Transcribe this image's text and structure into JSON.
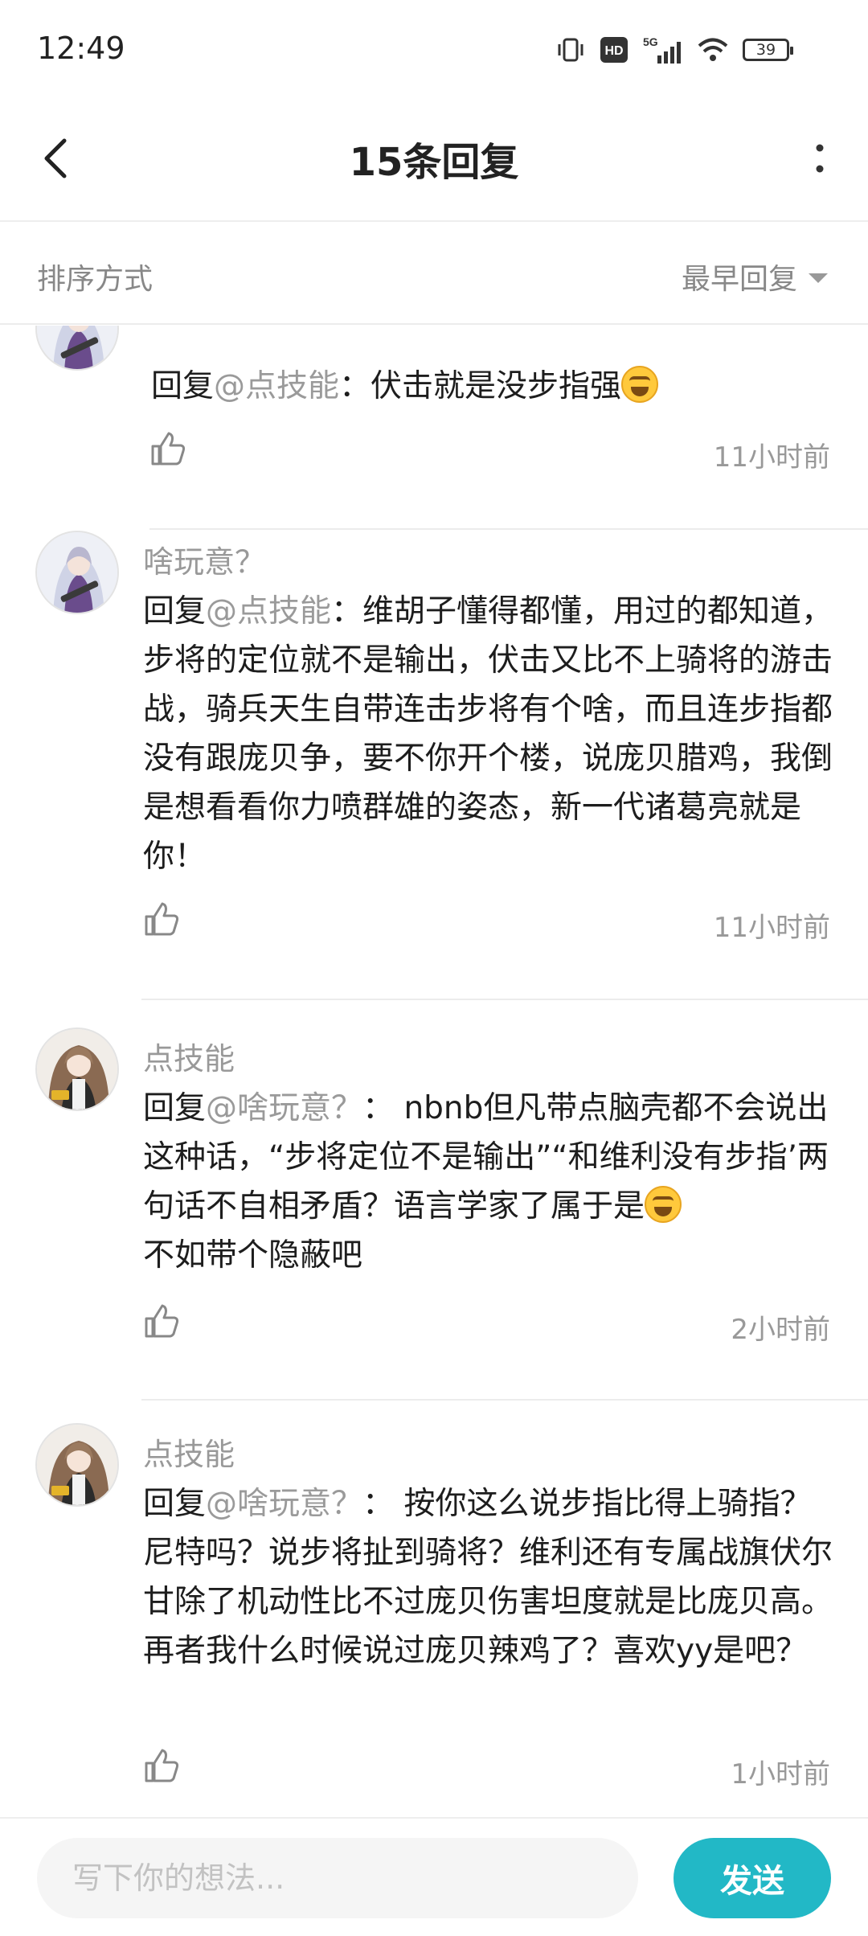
{
  "status_bar": {
    "time": "12:49",
    "network": "5G",
    "battery": "39",
    "icons": [
      "vibrate-icon",
      "hd-icon",
      "signal-5g-icon",
      "wifi-icon",
      "battery-icon"
    ]
  },
  "header": {
    "title": "15条回复",
    "back_icon": "chevron-left-icon",
    "more_icon": "more-vertical-icon"
  },
  "sort": {
    "label": "排序方式",
    "selected": "最早回复"
  },
  "comments": [
    {
      "author": "",
      "avatar": "avatar-purple-hair",
      "reply_prefix": "回复",
      "mention": "@点技能",
      "separator": "：",
      "text": "伏击就是没步指强",
      "emoji": "laughing-tears-emoji",
      "time": "11小时前"
    },
    {
      "author": "啥玩意？",
      "avatar": "avatar-purple-hair",
      "reply_prefix": "回复",
      "mention": "@点技能",
      "separator": "：",
      "text": "维胡子懂得都懂，用过的都知道，步将的定位就不是输出，伏击又比不上骑将的游击战，骑兵天生自带连击步将有个啥，而且连步指都没有跟庞贝争，要不你开个楼，说庞贝腊鸡，我倒是想看看你力喷群雄的姿态，新一代诸葛亮就是你！",
      "time": "11小时前"
    },
    {
      "author": "点技能",
      "avatar": "avatar-brown-hair",
      "reply_prefix": "回复",
      "mention": "@啥玩意？",
      "separator": "：",
      "text": "nbnb但凡带点脑壳都不会说出这种话，“步将定位不是输出”“和维利没有步指’两句话不自相矛盾？语言学家了属于是",
      "emoji": "laughing-tears-emoji",
      "text_after": "不如带个隐蔽吧",
      "time": "2小时前"
    },
    {
      "author": "点技能",
      "avatar": "avatar-brown-hair",
      "reply_prefix": "回复",
      "mention": "@啥玩意？",
      "separator": "：",
      "text": "按你这么说步指比得上骑指？尼特吗？说步将扯到骑将？维利还有专属战旗伏尔甘除了机动性比不过庞贝伤害坦度就是比庞贝高。再者我什么时候说过庞贝辣鸡了？喜欢yy是吧？",
      "time": "1小时前"
    }
  ],
  "composer": {
    "placeholder": "写下你的想法...",
    "send_label": "发送",
    "accent": "#22b8c6"
  }
}
